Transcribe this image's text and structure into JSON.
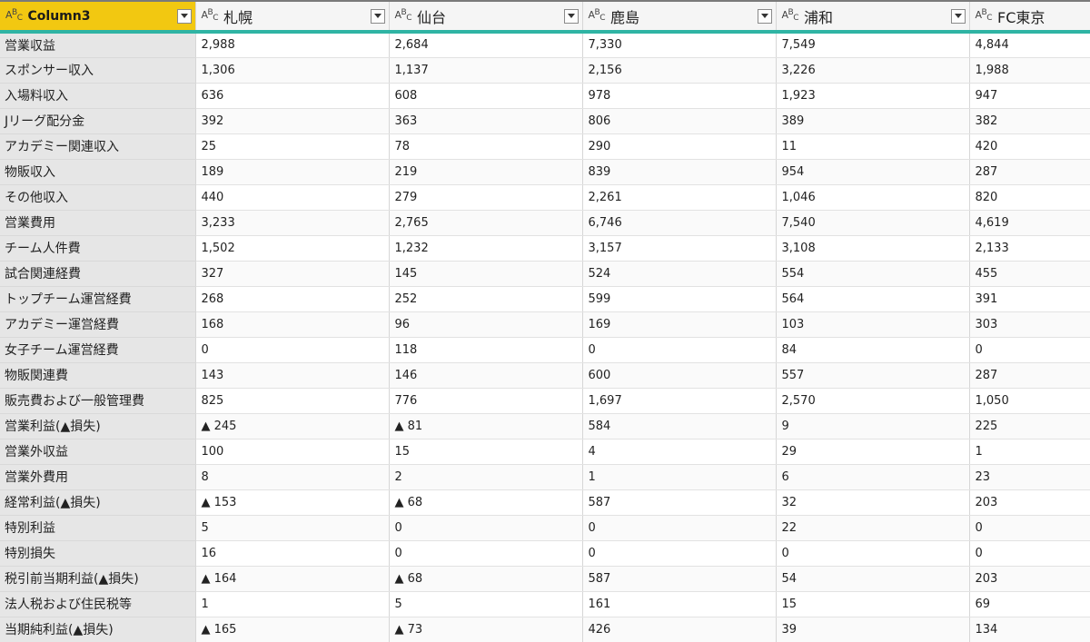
{
  "columns": [
    {
      "name": "Column3",
      "type_icon": "ABC-text-type-icon"
    },
    {
      "name": "札幌",
      "type_icon": "ABC-text-type-icon"
    },
    {
      "name": "仙台",
      "type_icon": "ABC-text-type-icon"
    },
    {
      "name": "鹿島",
      "type_icon": "ABC-text-type-icon"
    },
    {
      "name": "浦和",
      "type_icon": "ABC-text-type-icon"
    },
    {
      "name": "FC東京",
      "type_icon": "ABC-text-type-icon"
    }
  ],
  "type_icon_text": {
    "a": "A",
    "b": "B",
    "c": "C"
  },
  "colors": {
    "selected_header": "#f2c811",
    "header_underline": "#2fb4a4",
    "row_header_bg": "#e6e6e6"
  },
  "rows": [
    [
      "営業収益",
      "2,988",
      "2,684",
      "7,330",
      "7,549",
      "4,844"
    ],
    [
      "スポンサー収入",
      "1,306",
      "1,137",
      "2,156",
      "3,226",
      "1,988"
    ],
    [
      "入場料収入",
      "636",
      "608",
      "978",
      "1,923",
      "947"
    ],
    [
      "Jリーグ配分金",
      "392",
      "363",
      "806",
      "389",
      "382"
    ],
    [
      "アカデミー関連収入",
      "25",
      "78",
      "290",
      "11",
      "420"
    ],
    [
      "物販収入",
      "189",
      "219",
      "839",
      "954",
      "287"
    ],
    [
      "その他収入",
      "440",
      "279",
      "2,261",
      "1,046",
      "820"
    ],
    [
      "営業費用",
      "3,233",
      "2,765",
      "6,746",
      "7,540",
      "4,619"
    ],
    [
      "チーム人件費",
      "1,502",
      "1,232",
      "3,157",
      "3,108",
      "2,133"
    ],
    [
      "試合関連経費",
      "327",
      "145",
      "524",
      "554",
      "455"
    ],
    [
      "トップチーム運営経費",
      "268",
      "252",
      "599",
      "564",
      "391"
    ],
    [
      "アカデミー運営経費",
      "168",
      "96",
      "169",
      "103",
      "303"
    ],
    [
      "女子チーム運営経費",
      "0",
      "118",
      "0",
      "84",
      "0"
    ],
    [
      "物販関連費",
      "143",
      "146",
      "600",
      "557",
      "287"
    ],
    [
      "販売費および一般管理費",
      "825",
      "776",
      "1,697",
      "2,570",
      "1,050"
    ],
    [
      "営業利益(▲損失)",
      "▲ 245",
      "▲ 81",
      "584",
      "9",
      "225"
    ],
    [
      "営業外収益",
      "100",
      "15",
      "4",
      "29",
      "1"
    ],
    [
      "営業外費用",
      "8",
      "2",
      "1",
      "6",
      "23"
    ],
    [
      "経常利益(▲損失)",
      "▲ 153",
      "▲ 68",
      "587",
      "32",
      "203"
    ],
    [
      "特別利益",
      "5",
      "0",
      "0",
      "22",
      "0"
    ],
    [
      "特別損失",
      "16",
      "0",
      "0",
      "0",
      "0"
    ],
    [
      "税引前当期利益(▲損失)",
      "▲ 164",
      "▲ 68",
      "587",
      "54",
      "203"
    ],
    [
      "法人税および住民税等",
      "1",
      "5",
      "161",
      "15",
      "69"
    ],
    [
      "当期純利益(▲損失)",
      "▲ 165",
      "▲ 73",
      "426",
      "39",
      "134"
    ]
  ]
}
